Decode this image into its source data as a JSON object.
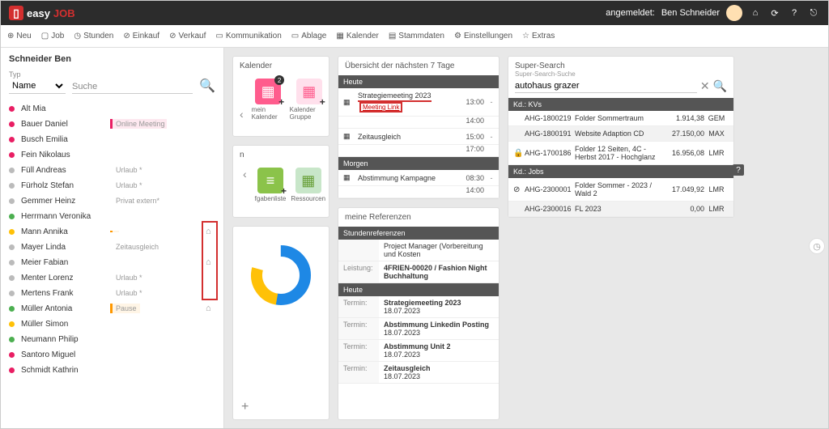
{
  "header": {
    "logo_easy": "easy",
    "logo_job": "JOB",
    "signed_in_prefix": "angemeldet:",
    "user_name": "Ben Schneider"
  },
  "menu": {
    "neu": "Neu",
    "job": "Job",
    "stunden": "Stunden",
    "einkauf": "Einkauf",
    "verkauf": "Verkauf",
    "komm": "Kommunikation",
    "ablage": "Ablage",
    "kalender": "Kalender",
    "stamm": "Stammdaten",
    "einst": "Einstellungen",
    "extras": "Extras"
  },
  "sidebar": {
    "title": "Schneider Ben",
    "typ_label": "Typ",
    "typ_value": "Name",
    "search_placeholder": "Suche",
    "people": [
      {
        "name": "Alt Mia",
        "color": "red"
      },
      {
        "name": "Bauer Daniel",
        "color": "red",
        "tag": "Online Meeting ...",
        "tagc": "pink"
      },
      {
        "name": "Busch Emilia",
        "color": "red"
      },
      {
        "name": "Fein Nikolaus",
        "color": "red"
      },
      {
        "name": "Füll Andreas",
        "color": "gray",
        "tag": "Urlaub *",
        "tagc": ""
      },
      {
        "name": "Fürholz Stefan",
        "color": "gray",
        "tag": "Urlaub *",
        "tagc": ""
      },
      {
        "name": "Gemmer Heinz",
        "color": "gray",
        "tag": "Privat extern*",
        "tagc": ""
      },
      {
        "name": "Herrmann Veronika",
        "color": "green"
      },
      {
        "name": "Mann Annika",
        "color": "yellow",
        "tag": "",
        "tagc": "orange",
        "bin": true
      },
      {
        "name": "Mayer Linda",
        "color": "gray",
        "tag": "Zeitausgleich",
        "tagc": ""
      },
      {
        "name": "Meier Fabian",
        "color": "gray",
        "bin": true
      },
      {
        "name": "Menter Lorenz",
        "color": "gray",
        "tag": "Urlaub *",
        "tagc": ""
      },
      {
        "name": "Mertens Frank",
        "color": "gray",
        "tag": "Urlaub *",
        "tagc": ""
      },
      {
        "name": "Müller Antonia",
        "color": "green",
        "tag": "Pause",
        "tagc": "orange",
        "bin": true
      },
      {
        "name": "Müller Simon",
        "color": "yellow"
      },
      {
        "name": "Neumann Philip",
        "color": "green"
      },
      {
        "name": "Santoro Miguel",
        "color": "red"
      },
      {
        "name": "Schmidt Kathrin",
        "color": "red"
      }
    ]
  },
  "kalender": {
    "title": "Kalender",
    "mein": "mein Kalender",
    "gruppe": "Kalender Gruppe",
    "badge": "2",
    "n_title": "n",
    "fgaben": "fgabenliste",
    "ress": "Ressourcen"
  },
  "tage7": {
    "title": "Übersicht der nächsten 7 Tage",
    "heute": "Heute",
    "morgen": "Morgen",
    "r1": {
      "txt": "Strategiemeeting 2023",
      "link": "Meeting Link",
      "t1": "13:00",
      "t2": "14:00"
    },
    "r2": {
      "txt": "Zeitausgleich",
      "t1": "15:00",
      "t2": "17:00"
    },
    "r3": {
      "txt": "Abstimmung Kampagne",
      "t1": "08:30",
      "t2": "14:00"
    },
    "dash": "-"
  },
  "refs": {
    "title": "meine Referenzen",
    "hdr": "Stundenreferenzen",
    "r1": {
      "v": "Project Manager (Vorbereitung und Kosten"
    },
    "r2": {
      "l": "Leistung:",
      "v": "4FRIEN-00020 / Fashion Night Buchhaltung"
    },
    "heute": "Heute",
    "termin": "Termin:",
    "t1": {
      "a": "Strategiemeeting 2023",
      "b": "18.07.2023"
    },
    "t2": {
      "a": "Abstimmung Linkedin Posting",
      "b": "18.07.2023"
    },
    "t3": {
      "a": "Abstimmung Unit 2",
      "b": "18.07.2023"
    },
    "t4": {
      "a": "Zeitausgleich",
      "b": "18.07.2023"
    }
  },
  "ss": {
    "title": "Super-Search",
    "sublabel": "Super-Search-Suche",
    "value": "autohaus grazer",
    "kv_hdr": "Kd.: KVs",
    "job_hdr": "Kd.: Jobs",
    "qmark": "?",
    "kvs": [
      {
        "id": "AHG-1800219",
        "txt": "Folder Sommertraum",
        "val": "1.914,38",
        "u": "GEM"
      },
      {
        "id": "AHG-1800191",
        "txt": "Website Adaption CD",
        "val": "27.150,00",
        "u": "MAX"
      },
      {
        "id": "AHG-1700186",
        "txt": "Folder 12 Seiten, 4C - Herbst 2017 - Hochglanz",
        "val": "16.956,08",
        "u": "LMR",
        "lock": true
      }
    ],
    "jobs": [
      {
        "id": "AHG-2300001",
        "txt": "Folder Sommer - 2023 / Wald 2",
        "val": "17.049,92",
        "u": "LMR",
        "check": true
      },
      {
        "id": "AHG-2300016",
        "txt": "FL 2023",
        "val": "0,00",
        "u": "LMR"
      }
    ]
  }
}
